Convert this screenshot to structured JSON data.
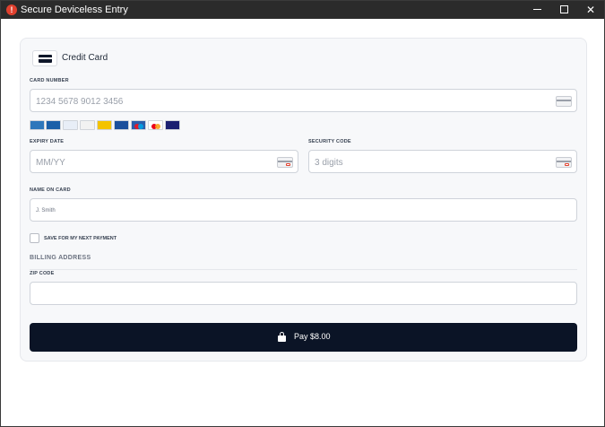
{
  "window": {
    "title": "Secure Deviceless Entry",
    "alert_glyph": "!",
    "controls": {
      "minimize": "minimize",
      "maximize": "maximize",
      "close": "✕"
    }
  },
  "form": {
    "heading": "Credit Card",
    "card_number": {
      "label": "CARD NUMBER",
      "placeholder": "1234 5678 9012 3456"
    },
    "brands": [
      {
        "name": "Amex",
        "short": "AMEX",
        "color": "#2e77bb"
      },
      {
        "name": "Diners Club",
        "short": "DC",
        "color": "#1a5fa8"
      },
      {
        "name": "Diners Club International",
        "short": "DCI",
        "color": "#e8eef7"
      },
      {
        "name": "Discover",
        "short": "DISC",
        "color": "#f2f2f2"
      },
      {
        "name": "Elo",
        "short": "ELO",
        "color": "#f4c300"
      },
      {
        "name": "JCB",
        "short": "JCB",
        "color": "#1b4f9c"
      },
      {
        "name": "Maestro",
        "short": "MAE",
        "color": "#2a5dab"
      },
      {
        "name": "Mastercard",
        "short": "MC",
        "color": "#ffffff"
      },
      {
        "name": "Visa",
        "short": "VISA",
        "color": "#1a1f71"
      }
    ],
    "expiry": {
      "label": "EXPIRY DATE",
      "placeholder": "MM/YY"
    },
    "security": {
      "label": "SECURITY CODE",
      "placeholder": "3 digits"
    },
    "name": {
      "label": "NAME ON CARD",
      "placeholder": "J. Smith"
    },
    "save": {
      "label": "SAVE FOR MY NEXT PAYMENT",
      "checked": false
    },
    "billing": {
      "heading": "BILLING ADDRESS"
    },
    "zip": {
      "label": "ZIP CODE",
      "value": ""
    },
    "pay_button": {
      "label": "Pay $8.00"
    }
  },
  "colors": {
    "accent": "#0b1426",
    "alert": "#e0402e",
    "titlebar": "#2b2b2b"
  }
}
